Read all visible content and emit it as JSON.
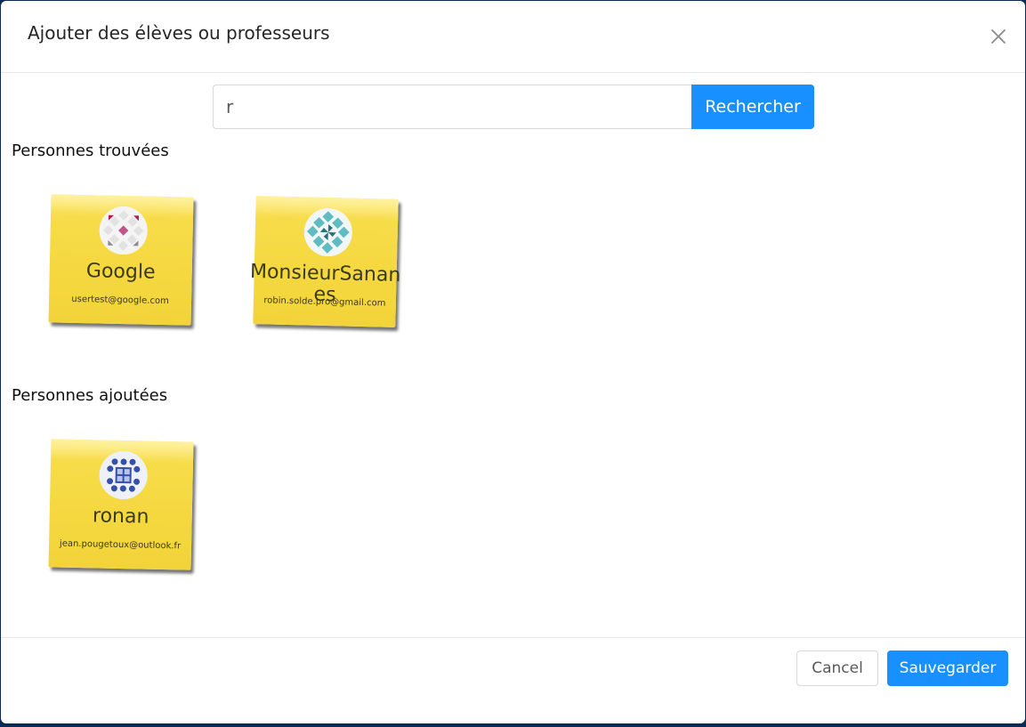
{
  "dialog": {
    "title": "Ajouter des élèves ou professeurs"
  },
  "search": {
    "value": "r",
    "button_label": "Rechercher"
  },
  "found": {
    "title": "Personnes trouvées",
    "people": [
      {
        "name": "Google",
        "email": "usertest@google.com",
        "avatar": "pink-diamond-pattern"
      },
      {
        "name": "MonsieurSananes",
        "email": "robin.solde.pro@gmail.com",
        "avatar": "teal-pinwheel-pattern"
      }
    ]
  },
  "added": {
    "title": "Personnes ajoutées",
    "people": [
      {
        "name": "ronan",
        "email": "jean.pougetoux@outlook.fr",
        "avatar": "blue-grid-pattern"
      }
    ]
  },
  "footer": {
    "cancel_label": "Cancel",
    "save_label": "Sauvegarder"
  },
  "colors": {
    "primary": "#1890ff",
    "note": "#f5d83f"
  }
}
